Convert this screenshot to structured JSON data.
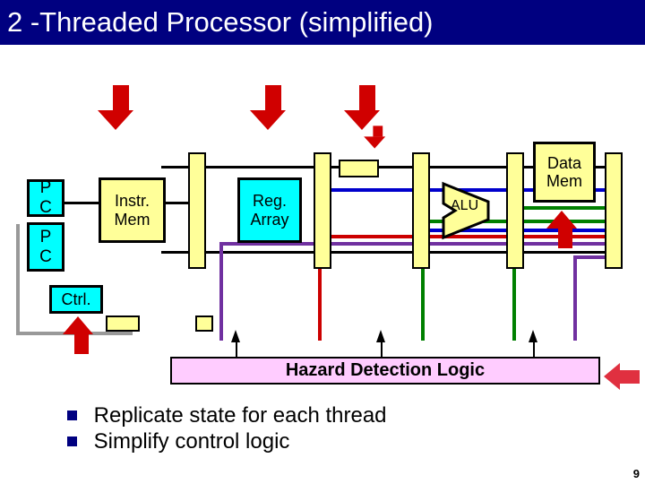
{
  "title": "2 -Threaded Processor (simplified)",
  "blocks": {
    "pc1": "P\nC",
    "pc2": "P\nC",
    "imem": "Instr.\nMem",
    "regarray": "Reg.\nArray",
    "alu": "ALU",
    "dmem": "Data\nMem",
    "ctrl": "Ctrl."
  },
  "hazard_label": "Hazard Detection Logic",
  "bullets": [
    "Replicate state for each thread",
    "Simplify control logic"
  ],
  "page_number": "9",
  "colors": {
    "navy": "#000080",
    "cyan": "#00ffff",
    "yellow": "#ffff99",
    "pink": "#ffccff",
    "red_arrow": "#d00000",
    "purple": "#7030a0",
    "green": "#008000",
    "blue": "#0000cc"
  }
}
